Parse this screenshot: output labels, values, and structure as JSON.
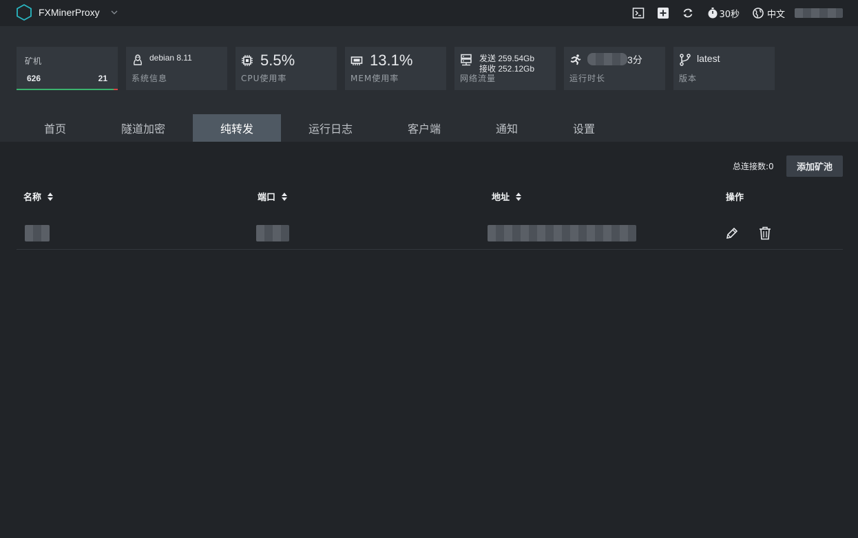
{
  "app": {
    "name": "FXMinerProxy"
  },
  "top_actions": {
    "refresh_interval": "30秒",
    "language": "中文"
  },
  "stats": {
    "miners": {
      "title": "矿机",
      "online": "626",
      "offline": "21",
      "online_fraction": 0.96
    },
    "system": {
      "value": "debian 8.11",
      "label": "系统信息"
    },
    "cpu": {
      "value": "5.5%",
      "label": "CPU使用率"
    },
    "mem": {
      "value": "13.1%",
      "label": "MEM使用率"
    },
    "network": {
      "sent": "发送 259.54Gb",
      "received": "接收 252.12Gb",
      "label": "网络流量"
    },
    "uptime": {
      "value_suffix": "3分",
      "label": "运行时长"
    },
    "version": {
      "value": "latest",
      "label": "版本"
    }
  },
  "tabs": [
    {
      "label": "首页",
      "active": false
    },
    {
      "label": "隧道加密",
      "active": false
    },
    {
      "label": "纯转发",
      "active": true
    },
    {
      "label": "运行日志",
      "active": false
    },
    {
      "label": "客户端",
      "active": false
    },
    {
      "label": "通知",
      "active": false
    },
    {
      "label": "设置",
      "active": false
    }
  ],
  "toolbar": {
    "total_connections": "总连接数:0",
    "add_pool_label": "添加矿池"
  },
  "table": {
    "columns": [
      "名称",
      "端口",
      "地址",
      "操作"
    ]
  },
  "colors": {
    "background": "#212428",
    "header_background": "#2a2e33",
    "card_background": "#33383e",
    "active_tab": "#4f5963",
    "online_bar": "#3bb36e",
    "offline_bar": "#d64545",
    "logo_accent": "#2ab7c2"
  }
}
